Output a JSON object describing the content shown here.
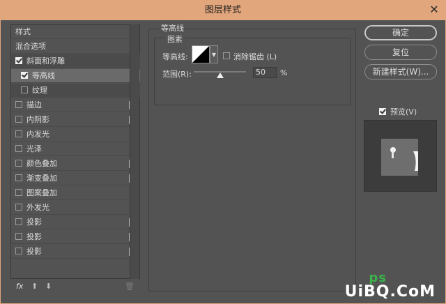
{
  "window": {
    "title": "图层样式",
    "close_glyph": "✕"
  },
  "style_list": {
    "header": "样式",
    "blend_options": "混合选项",
    "items": [
      {
        "label": "斜面和浮雕",
        "checked": true,
        "plus": false
      },
      {
        "label": "等高线",
        "checked": true,
        "plus": false
      },
      {
        "label": "纹理",
        "checked": false,
        "plus": false
      },
      {
        "label": "描边",
        "checked": false,
        "plus": true
      },
      {
        "label": "内阴影",
        "checked": false,
        "plus": true
      },
      {
        "label": "内发光",
        "checked": false,
        "plus": false
      },
      {
        "label": "光泽",
        "checked": false,
        "plus": false
      },
      {
        "label": "颜色叠加",
        "checked": false,
        "plus": true
      },
      {
        "label": "渐变叠加",
        "checked": false,
        "plus": true
      },
      {
        "label": "图案叠加",
        "checked": false,
        "plus": false
      },
      {
        "label": "外发光",
        "checked": false,
        "plus": false
      },
      {
        "label": "投影",
        "checked": false,
        "plus": true
      },
      {
        "label": "投影",
        "checked": false,
        "plus": true
      },
      {
        "label": "投影",
        "checked": false,
        "plus": true
      }
    ],
    "plus_glyph": "+",
    "tools": {
      "fx": "fx",
      "up": "⬆",
      "down": "⬇",
      "trash": "🗑"
    }
  },
  "contour_panel": {
    "title": "等高线",
    "group_title": "图素",
    "contour_label": "等高线:",
    "antialias_label": "消除锯齿 (L)",
    "range_label": "范围(R):",
    "range_value": "50",
    "range_unit": "%",
    "range_percent": 50
  },
  "buttons": {
    "ok": "确定",
    "reset": "复位",
    "new_style": "新建样式(W)...",
    "preview": "预览(V)"
  },
  "watermark": {
    "text": "UiBQ.CoM",
    "ps": "ps"
  }
}
